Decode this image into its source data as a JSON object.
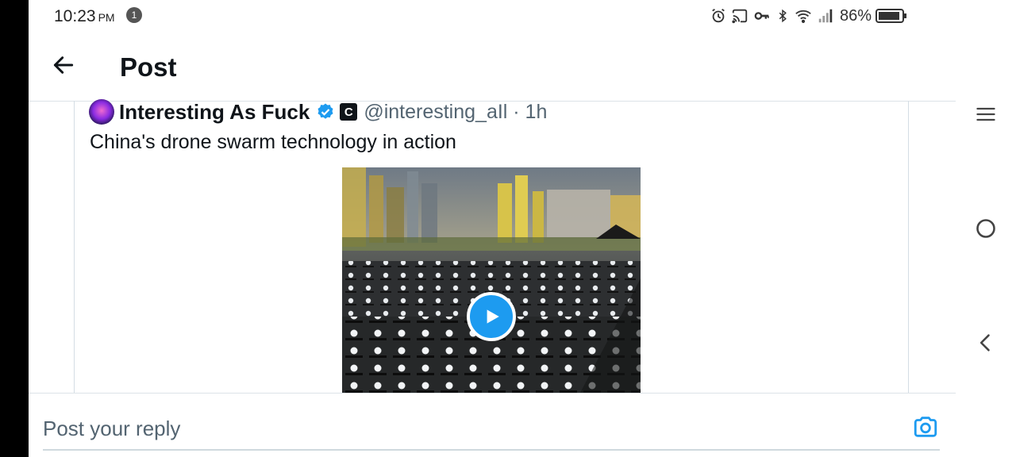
{
  "status_bar": {
    "time": "10:23",
    "ampm": "PM",
    "notification_count": "1",
    "battery": "86%"
  },
  "header": {
    "title": "Post",
    "back_icon": "arrow-left-icon"
  },
  "quoted_post": {
    "author_name": "Interesting As Fuck",
    "affiliate_badge": "C",
    "handle_time": "@interesting_aIl · 1h",
    "text": "China's drone swarm technology in action",
    "media": {
      "type": "video",
      "play_icon": "play-icon"
    }
  },
  "reply": {
    "placeholder": "Post your reply",
    "camera_icon": "camera-icon"
  },
  "nav_bar": {
    "icons": [
      "recents-icon",
      "home-icon",
      "back-icon"
    ]
  },
  "colors": {
    "accent": "#1d9bf0",
    "text": "#0f1419",
    "secondary_text": "#536471",
    "divider": "#dde3e8"
  }
}
